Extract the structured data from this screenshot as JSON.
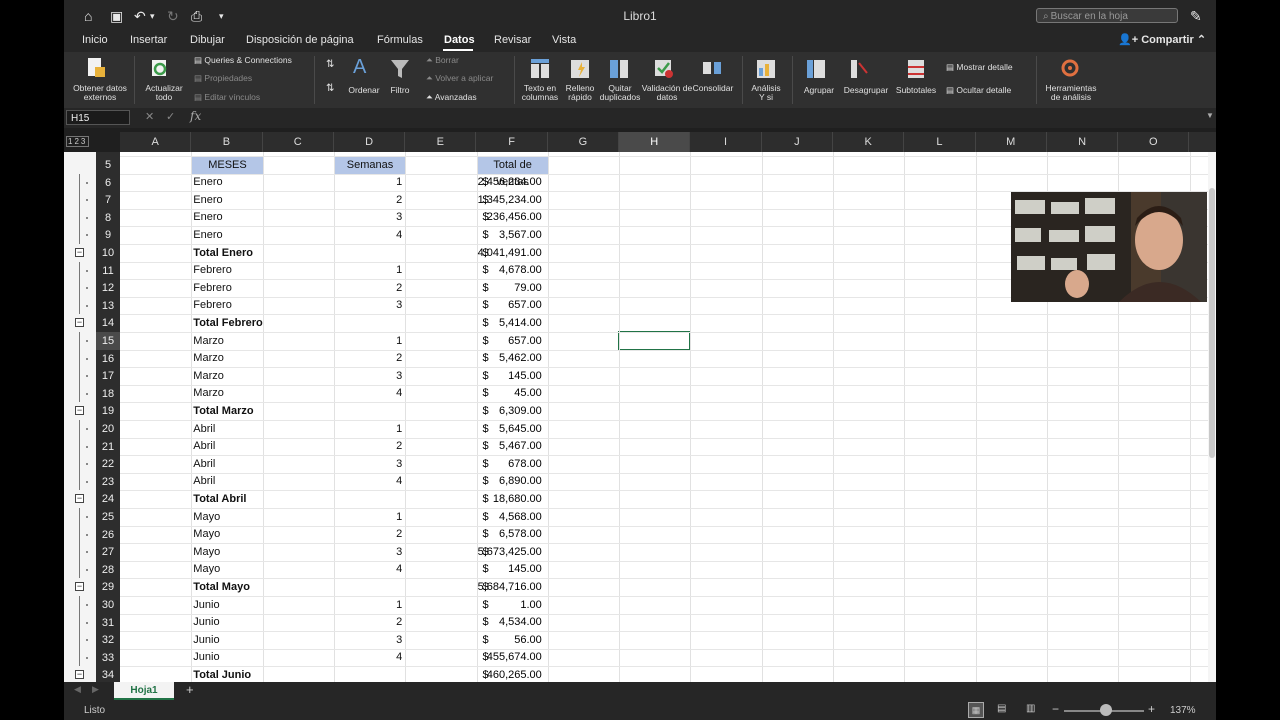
{
  "window": {
    "title": "Libro1",
    "search_placeholder": "Buscar en la hoja",
    "share_label": "Compartir"
  },
  "tabs": [
    {
      "label": "Inicio"
    },
    {
      "label": "Insertar"
    },
    {
      "label": "Dibujar"
    },
    {
      "label": "Disposición de página"
    },
    {
      "label": "Fórmulas"
    },
    {
      "label": "Datos"
    },
    {
      "label": "Revisar"
    },
    {
      "label": "Vista"
    }
  ],
  "ribbon": {
    "obtener_line1": "Obtener datos",
    "obtener_line2": "externos",
    "actualizar_line1": "Actualizar",
    "actualizar_line2": "todo",
    "queries": "Queries & Connections",
    "propiedades": "Propiedades",
    "editar_vinculos": "Editar vínculos",
    "ordenar": "Ordenar",
    "filtro": "Filtro",
    "borrar": "Borrar",
    "volver": "Volver a aplicar",
    "avanzadas": "Avanzadas",
    "texto_line1": "Texto en",
    "texto_line2": "columnas",
    "relleno_line1": "Relleno",
    "relleno_line2": "rápido",
    "quitar_line1": "Quitar",
    "quitar_line2": "duplicados",
    "validacion_line1": "Validación de",
    "validacion_line2": "datos",
    "consolidar": "Consolidar",
    "analisis_line1": "Análisis",
    "analisis_line2": "Y si",
    "agrupar": "Agrupar",
    "desagrupar": "Desagrupar",
    "subtotales": "Subtotales",
    "mostrar_detalle": "Mostrar detalle",
    "ocultar_detalle": "Ocultar detalle",
    "herramientas_line1": "Herramientas",
    "herramientas_line2": "de análisis"
  },
  "formula_bar": {
    "name_box": "H15",
    "fx": "fx",
    "value": ""
  },
  "outline_levels": [
    "1",
    "2",
    "3"
  ],
  "columns": [
    "A",
    "B",
    "C",
    "D",
    "E",
    "F",
    "G",
    "H",
    "I",
    "J",
    "K",
    "L",
    "M",
    "N",
    "O"
  ],
  "selected_column": "H",
  "selected_row": "15",
  "header_row": {
    "row": "5",
    "b": "MESES",
    "d": "Semanas",
    "f": "Total de ventas"
  },
  "rows": [
    {
      "row": "6",
      "b": "Enero",
      "d": "1",
      "f": "2,456,234.00",
      "total": false
    },
    {
      "row": "7",
      "b": "Enero",
      "d": "2",
      "f": "1,345,234.00",
      "total": false
    },
    {
      "row": "8",
      "b": "Enero",
      "d": "3",
      "f": "236,456.00",
      "total": false
    },
    {
      "row": "9",
      "b": "Enero",
      "d": "4",
      "f": "3,567.00",
      "total": false
    },
    {
      "row": "10",
      "b": "Total Enero",
      "d": "",
      "f": "4,041,491.00",
      "total": true
    },
    {
      "row": "11",
      "b": "Febrero",
      "d": "1",
      "f": "4,678.00",
      "total": false
    },
    {
      "row": "12",
      "b": "Febrero",
      "d": "2",
      "f": "79.00",
      "total": false
    },
    {
      "row": "13",
      "b": "Febrero",
      "d": "3",
      "f": "657.00",
      "total": false
    },
    {
      "row": "14",
      "b": "Total Febrero",
      "d": "",
      "f": "5,414.00",
      "total": true
    },
    {
      "row": "15",
      "b": "Marzo",
      "d": "1",
      "f": "657.00",
      "total": false
    },
    {
      "row": "16",
      "b": "Marzo",
      "d": "2",
      "f": "5,462.00",
      "total": false
    },
    {
      "row": "17",
      "b": "Marzo",
      "d": "3",
      "f": "145.00",
      "total": false
    },
    {
      "row": "18",
      "b": "Marzo",
      "d": "4",
      "f": "45.00",
      "total": false
    },
    {
      "row": "19",
      "b": "Total Marzo",
      "d": "",
      "f": "6,309.00",
      "total": true
    },
    {
      "row": "20",
      "b": "Abril",
      "d": "1",
      "f": "5,645.00",
      "total": false
    },
    {
      "row": "21",
      "b": "Abril",
      "d": "2",
      "f": "5,467.00",
      "total": false
    },
    {
      "row": "22",
      "b": "Abril",
      "d": "3",
      "f": "678.00",
      "total": false
    },
    {
      "row": "23",
      "b": "Abril",
      "d": "4",
      "f": "6,890.00",
      "total": false
    },
    {
      "row": "24",
      "b": "Total Abril",
      "d": "",
      "f": "18,680.00",
      "total": true
    },
    {
      "row": "25",
      "b": "Mayo",
      "d": "1",
      "f": "4,568.00",
      "total": false
    },
    {
      "row": "26",
      "b": "Mayo",
      "d": "2",
      "f": "6,578.00",
      "total": false
    },
    {
      "row": "27",
      "b": "Mayo",
      "d": "3",
      "f": "5,673,425.00",
      "total": false
    },
    {
      "row": "28",
      "b": "Mayo",
      "d": "4",
      "f": "145.00",
      "total": false
    },
    {
      "row": "29",
      "b": "Total Mayo",
      "d": "",
      "f": "5,684,716.00",
      "total": true
    },
    {
      "row": "30",
      "b": "Junio",
      "d": "1",
      "f": "1.00",
      "total": false
    },
    {
      "row": "31",
      "b": "Junio",
      "d": "2",
      "f": "4,534.00",
      "total": false
    },
    {
      "row": "32",
      "b": "Junio",
      "d": "3",
      "f": "56.00",
      "total": false
    },
    {
      "row": "33",
      "b": "Junio",
      "d": "4",
      "f": "455,674.00",
      "total": false
    },
    {
      "row": "34",
      "b": "Total Junio",
      "d": "",
      "f": "460,265.00",
      "total": true
    }
  ],
  "currency_symbol": "$",
  "sheet_tab": "Hoja1",
  "status": {
    "ready": "Listo",
    "zoom": "137%"
  },
  "colors": {
    "accent": "#217346",
    "header_fill": "#b4c6e7",
    "chrome": "#262626"
  }
}
